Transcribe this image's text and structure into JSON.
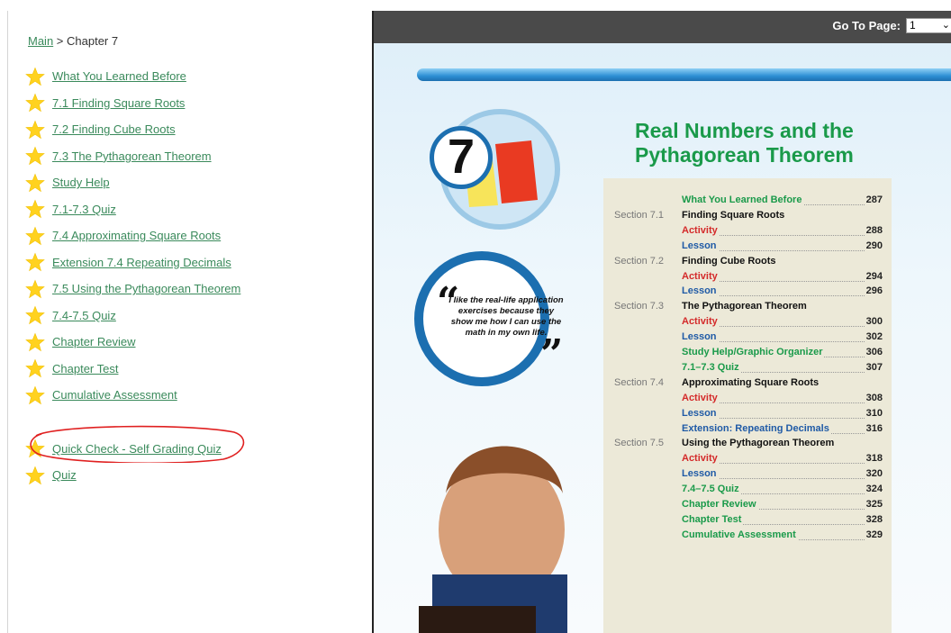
{
  "breadcrumb": {
    "root": "Main",
    "separator": " > ",
    "current": "Chapter 7"
  },
  "nav": [
    {
      "label": "What You Learned Before"
    },
    {
      "label": "7.1 Finding Square Roots"
    },
    {
      "label": "7.2 Finding Cube Roots"
    },
    {
      "label": "7.3 The Pythagorean Theorem"
    },
    {
      "label": "Study Help"
    },
    {
      "label": "7.1-7.3 Quiz"
    },
    {
      "label": "7.4 Approximating Square Roots"
    },
    {
      "label": "Extension 7.4 Repeating Decimals"
    },
    {
      "label": "7.5 Using the Pythagorean Theorem"
    },
    {
      "label": "7.4-7.5 Quiz"
    },
    {
      "label": "Chapter Review"
    },
    {
      "label": "Chapter Test"
    },
    {
      "label": "Cumulative Assessment"
    }
  ],
  "extra_nav": [
    {
      "label": "Quick Check - Self Grading Quiz"
    },
    {
      "label": "Quiz"
    }
  ],
  "toolbar": {
    "goto_label": "Go To Page:",
    "page_value": "1"
  },
  "book": {
    "chapter_number": "7",
    "title_line1": "Real Numbers and the",
    "title_line2": "Pythagorean Theorem",
    "quote": "I like the real-life application exercises because they show me how I can use the math in my own life.",
    "toc": [
      {
        "section": "",
        "text": "What You Learned Before",
        "page": "287",
        "color": "green"
      },
      {
        "section": "Section 7.1",
        "text": "Finding Square Roots",
        "page": "",
        "color": "black"
      },
      {
        "section": "",
        "text": "Activity",
        "page": "288",
        "color": "red"
      },
      {
        "section": "",
        "text": "Lesson",
        "page": "290",
        "color": "blue"
      },
      {
        "section": "Section 7.2",
        "text": "Finding Cube Roots",
        "page": "",
        "color": "black"
      },
      {
        "section": "",
        "text": "Activity",
        "page": "294",
        "color": "red"
      },
      {
        "section": "",
        "text": "Lesson",
        "page": "296",
        "color": "blue"
      },
      {
        "section": "Section 7.3",
        "text": "The Pythagorean Theorem",
        "page": "",
        "color": "black"
      },
      {
        "section": "",
        "text": "Activity",
        "page": "300",
        "color": "red"
      },
      {
        "section": "",
        "text": "Lesson",
        "page": "302",
        "color": "blue"
      },
      {
        "section": "",
        "text": "Study Help/Graphic Organizer",
        "page": "306",
        "color": "green"
      },
      {
        "section": "",
        "text": "7.1–7.3 Quiz",
        "page": "307",
        "color": "green"
      },
      {
        "section": "Section 7.4",
        "text": "Approximating Square Roots",
        "page": "",
        "color": "black"
      },
      {
        "section": "",
        "text": "Activity",
        "page": "308",
        "color": "red"
      },
      {
        "section": "",
        "text": "Lesson",
        "page": "310",
        "color": "blue"
      },
      {
        "section": "",
        "text": "Extension: Repeating Decimals",
        "page": "316",
        "color": "blue"
      },
      {
        "section": "Section 7.5",
        "text": "Using the Pythagorean Theorem",
        "page": "",
        "color": "black"
      },
      {
        "section": "",
        "text": "Activity",
        "page": "318",
        "color": "red"
      },
      {
        "section": "",
        "text": "Lesson",
        "page": "320",
        "color": "blue"
      },
      {
        "section": "",
        "text": "7.4–7.5 Quiz",
        "page": "324",
        "color": "green"
      },
      {
        "section": "",
        "text": "Chapter Review",
        "page": "325",
        "color": "green"
      },
      {
        "section": "",
        "text": "Chapter Test",
        "page": "328",
        "color": "green"
      },
      {
        "section": "",
        "text": "Cumulative Assessment",
        "page": "329",
        "color": "green"
      }
    ]
  },
  "colors": {
    "link": "#3a8a5b",
    "star": "#ffd21f",
    "toolbar": "#4a4a4a",
    "title_green": "#1a9a4a",
    "annotation_red": "#e02020"
  }
}
